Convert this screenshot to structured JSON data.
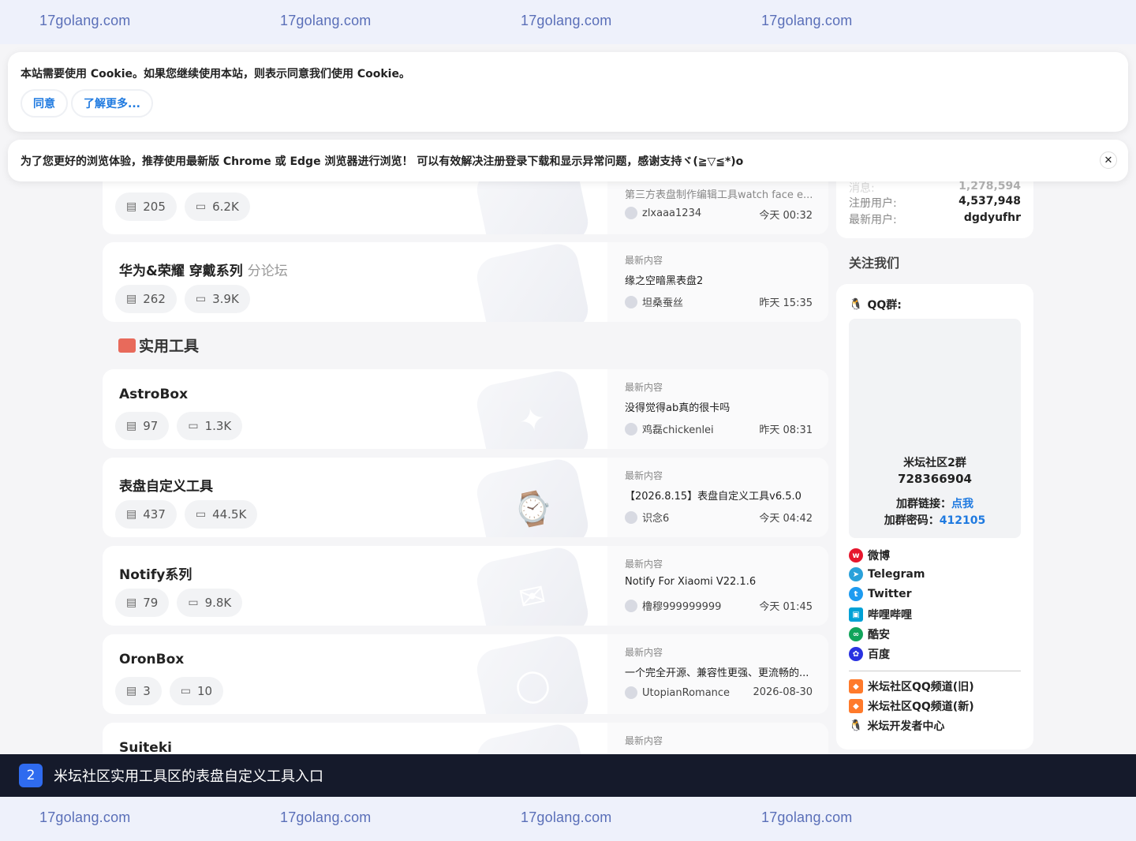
{
  "watermark": {
    "text": "17golang.com"
  },
  "cookie": {
    "message": "本站需要使用 Cookie。如果您继续使用本站，则表示同意我们使用 Cookie。",
    "agree_label": "同意",
    "more_label": "了解更多..."
  },
  "notice": {
    "message": "为了您更好的浏览体验，推荐使用最新版 Chrome 或 Edge 浏览器进行浏览！ 可以有效解决注册登录下载和显示异常问题，感谢支持ヾ(≧▽≦*)o",
    "close_label": "✕"
  },
  "forums_top": [
    {
      "title": "",
      "subtitle": "",
      "threads": "205",
      "posts": "6.2K",
      "latest_label": "",
      "latest": "第三方表盘制作编辑工具watch face e...",
      "author": "zlxaaa1234",
      "time": "今天 00:32"
    },
    {
      "title": "华为&荣耀 穿戴系列",
      "subtitle": "分论坛",
      "threads": "262",
      "posts": "3.9K",
      "latest_label": "最新内容",
      "latest": "缘之空暗黑表盘2",
      "author": "坦桑蚕丝",
      "time": "昨天 15:35"
    }
  ],
  "section_tools": {
    "title": "实用工具"
  },
  "forums_tools": [
    {
      "title": "AstroBox",
      "threads": "97",
      "posts": "1.3K",
      "latest_label": "最新内容",
      "latest": "没得觉得ab真的很卡吗",
      "author": "鸡磊chickenlei",
      "time": "昨天 08:31"
    },
    {
      "title": "表盘自定义工具",
      "threads": "437",
      "posts": "44.5K",
      "latest_label": "最新内容",
      "latest": "【2026.8.15】表盘自定义工具v6.5.0",
      "author": "识念6",
      "time": "今天 04:42"
    },
    {
      "title": "Notify系列",
      "threads": "79",
      "posts": "9.8K",
      "latest_label": "最新内容",
      "latest": "Notify For Xiaomi V22.1.6",
      "author": "橹穆999999999",
      "time": "今天 01:45"
    },
    {
      "title": "OronBox",
      "threads": "3",
      "posts": "10",
      "latest_label": "最新内容",
      "latest": "一个完全开源、兼容性更强、更流畅的...",
      "author": "UtopianRomance",
      "time": "2026-08-30"
    },
    {
      "title": "Suiteki",
      "latest_label": "最新内容"
    }
  ],
  "stats": {
    "posts_label": "消息:",
    "posts_value": "1,278,594",
    "users_label": "注册用户:",
    "users_value": "4,537,948",
    "newest_label": "最新用户:",
    "newest_value": "dgdyufhr"
  },
  "follow": {
    "title": "关注我们",
    "qq_label": "QQ群:",
    "group_name": "米坛社区2群",
    "group_number": "728366904",
    "join_link_label": "加群链接：",
    "join_link_text": "点我",
    "join_pwd_label": "加群密码：",
    "join_pwd_value": "412105",
    "socials": [
      {
        "name": "微博",
        "icon": "weibo-icon",
        "color": "#e6162d"
      },
      {
        "name": "Telegram",
        "icon": "telegram-icon",
        "color": "#2aa1da"
      },
      {
        "name": "Twitter",
        "icon": "twitter-icon",
        "color": "#1d9bf0"
      },
      {
        "name": "哔哩哔哩",
        "icon": "bilibili-icon",
        "color": "#00a1d6"
      },
      {
        "name": "酷安",
        "icon": "coolapk-icon",
        "color": "#11a45b"
      },
      {
        "name": "百度",
        "icon": "baidu-icon",
        "color": "#2932e1"
      }
    ],
    "channels": [
      {
        "name": "米坛社区QQ频道(旧)",
        "icon": "qq-channel-icon"
      },
      {
        "name": "米坛社区QQ频道(新)",
        "icon": "qq-channel-icon"
      },
      {
        "name": "米坛开发者中心",
        "icon": "qq-icon"
      }
    ]
  },
  "task": {
    "number": "2",
    "text": "米坛社区实用工具区的表盘自定义工具入口"
  }
}
